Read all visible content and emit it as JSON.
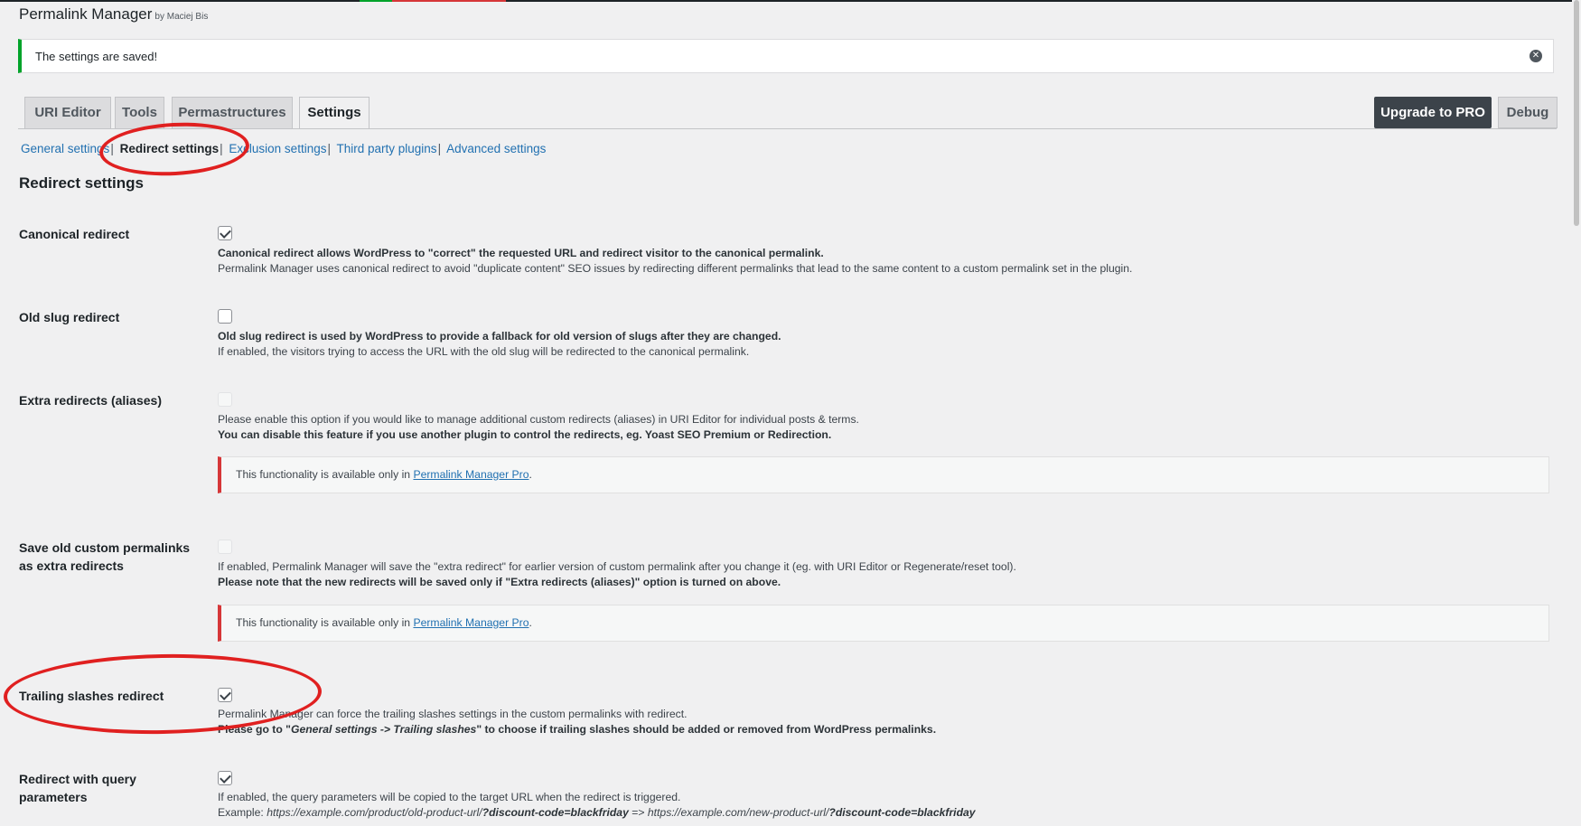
{
  "app": {
    "title": "Permalink Manager",
    "by": "by Maciej Bis"
  },
  "notice": {
    "message": "The settings are saved!"
  },
  "tabs": [
    {
      "label": "URI Editor"
    },
    {
      "label": "Tools"
    },
    {
      "label": "Permastructures"
    },
    {
      "label": "Settings"
    }
  ],
  "actions": {
    "upgrade": "Upgrade to PRO",
    "debug": "Debug"
  },
  "subnav": [
    {
      "label": "General settings"
    },
    {
      "label": "Redirect settings"
    },
    {
      "label": "Exclusion settings"
    },
    {
      "label": "Third party plugins"
    },
    {
      "label": "Advanced settings"
    }
  ],
  "section_title": "Redirect settings",
  "settings": [
    {
      "label": "Canonical redirect",
      "checked": true,
      "desc1": "Canonical redirect allows WordPress to \"correct\" the requested URL and redirect visitor to the canonical permalink.",
      "desc2": "Permalink Manager uses canonical redirect to avoid \"duplicate content\" SEO issues by redirecting different permalinks that lead to the same content to a custom permalink set in the plugin."
    },
    {
      "label": "Old slug redirect",
      "checked": false,
      "desc1": "Old slug redirect is used by WordPress to provide a fallback for old version of slugs after they are changed.",
      "desc2": "If enabled, the visitors trying to access the URL with the old slug will be redirected to the canonical permalink."
    },
    {
      "label": "Extra redirects (aliases)",
      "checked": false,
      "desc1": "Please enable this option if you would like to manage additional custom redirects (aliases) in URI Editor for individual posts & terms.",
      "desc2": "You can disable this feature if you use another plugin to control the redirects, eg. Yoast SEO Premium or Redirection.",
      "pro_text": "This functionality is available only in ",
      "pro_link": "Permalink Manager Pro",
      "pro_end": "."
    },
    {
      "label_line1": "Save old custom permalinks",
      "label_line2": "as extra redirects",
      "checked": false,
      "desc1": "If enabled, Permalink Manager will save the \"extra redirect\" for earlier version of custom permalink after you change it (eg. with URI Editor or Regenerate/reset tool).",
      "desc2": "Please note that the new redirects will be saved only if \"Extra redirects (aliases)\" option is turned on above.",
      "pro_text": "This functionality is available only in ",
      "pro_link": "Permalink Manager Pro",
      "pro_end": "."
    },
    {
      "label": "Trailing slashes redirect",
      "checked": true,
      "desc1": "Permalink Manager can force the trailing slashes settings in the custom permalinks with redirect.",
      "desc2_a": "Please go to \"",
      "desc2_em": "General settings -> Trailing slashes",
      "desc2_b": "\" to choose if trailing slashes should be added or removed from WordPress permalinks."
    },
    {
      "label_line1": "Redirect with query",
      "label_line2": "parameters",
      "checked": true,
      "desc1": "If enabled, the query parameters will be copied to the target URL when the redirect is triggered.",
      "ex_label": "Example: ",
      "ex_url1": "https://example.com/product/old-product-url/",
      "ex_q1": "?discount-code=blackfriday",
      "ex_arrow": " => ",
      "ex_url2": "https://example.com/new-product-url/",
      "ex_q2": "?discount-code=blackfriday"
    }
  ]
}
